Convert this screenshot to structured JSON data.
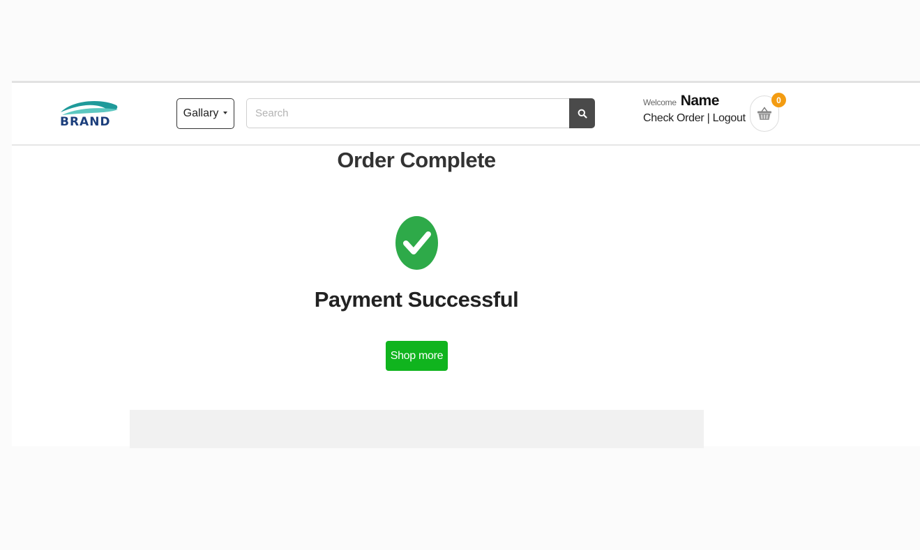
{
  "header": {
    "logo_text": "BRAND",
    "gallery_label": "Gallary",
    "search_placeholder": "Search",
    "welcome_label": "Welcome",
    "user_name": "Name",
    "check_order_label": "Check Order",
    "separator": "|",
    "logout_label": "Logout",
    "cart_count": "0"
  },
  "main": {
    "title": "Order Complete",
    "status_text": "Payment Successful",
    "shop_more_label": "Shop more"
  },
  "colors": {
    "success_green": "#2eaa49",
    "button_green": "#10b41e",
    "badge_orange": "#f39c12",
    "brand_navy": "#1c3f7c",
    "brand_teal": "#1f9a9a"
  },
  "icons": {
    "search": "search-icon",
    "cart": "basket-icon",
    "success": "check-circle-icon",
    "dropdown": "caret-down-icon"
  }
}
